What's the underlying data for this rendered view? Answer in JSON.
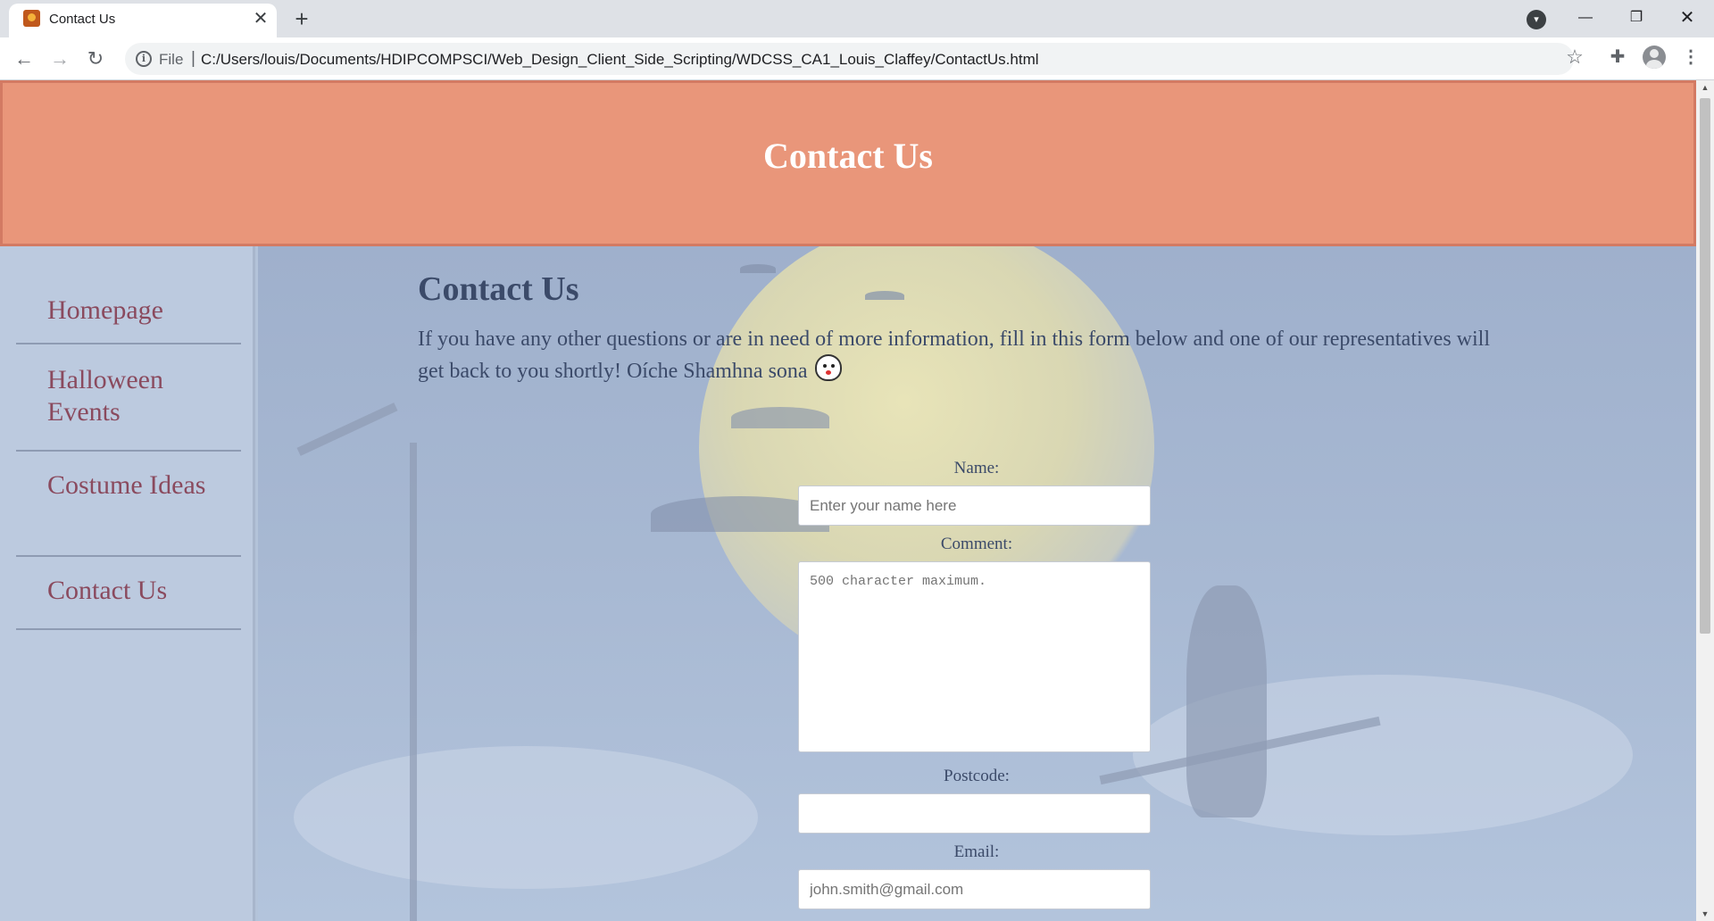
{
  "browser": {
    "tab_title": "Contact Us",
    "tab_close": "✕",
    "new_tab": "+",
    "url_scheme": "File",
    "url_separator": "|",
    "url": "C:/Users/louis/Documents/HDIPCOMPSCI/Web_Design_Client_Side_Scripting/WDCSS_CA1_Louis_Claffey/ContactUs.html",
    "icons": [
      "back-icon",
      "forward-icon",
      "reload-icon",
      "info-icon",
      "star-icon",
      "extensions-icon",
      "avatar",
      "menu-icon"
    ]
  },
  "header": {
    "title": "Contact Us"
  },
  "sidebar": {
    "items": [
      {
        "label": "Homepage"
      },
      {
        "label": "Halloween Events"
      },
      {
        "label": "Costume Ideas"
      },
      {
        "label": "Contact Us"
      }
    ]
  },
  "main": {
    "title": "Contact Us",
    "intro": "If you have any other questions or are in need of more information, fill in this form below and one of our representatives will get back to you shortly! Oíche Shamhna sona"
  },
  "form": {
    "name_label": "Name:",
    "name_placeholder": "Enter your name here",
    "comment_label": "Comment:",
    "comment_placeholder": "500 character maximum.",
    "postcode_label": "Postcode:",
    "postcode_placeholder": "",
    "email_label": "Email:",
    "email_placeholder": "john.smith@gmail.com"
  },
  "colors": {
    "header_bg": "#e9967a",
    "sidebar_bg": "#bccadf",
    "nav_text": "#8a4a5e",
    "body_text": "#3b4a69"
  }
}
